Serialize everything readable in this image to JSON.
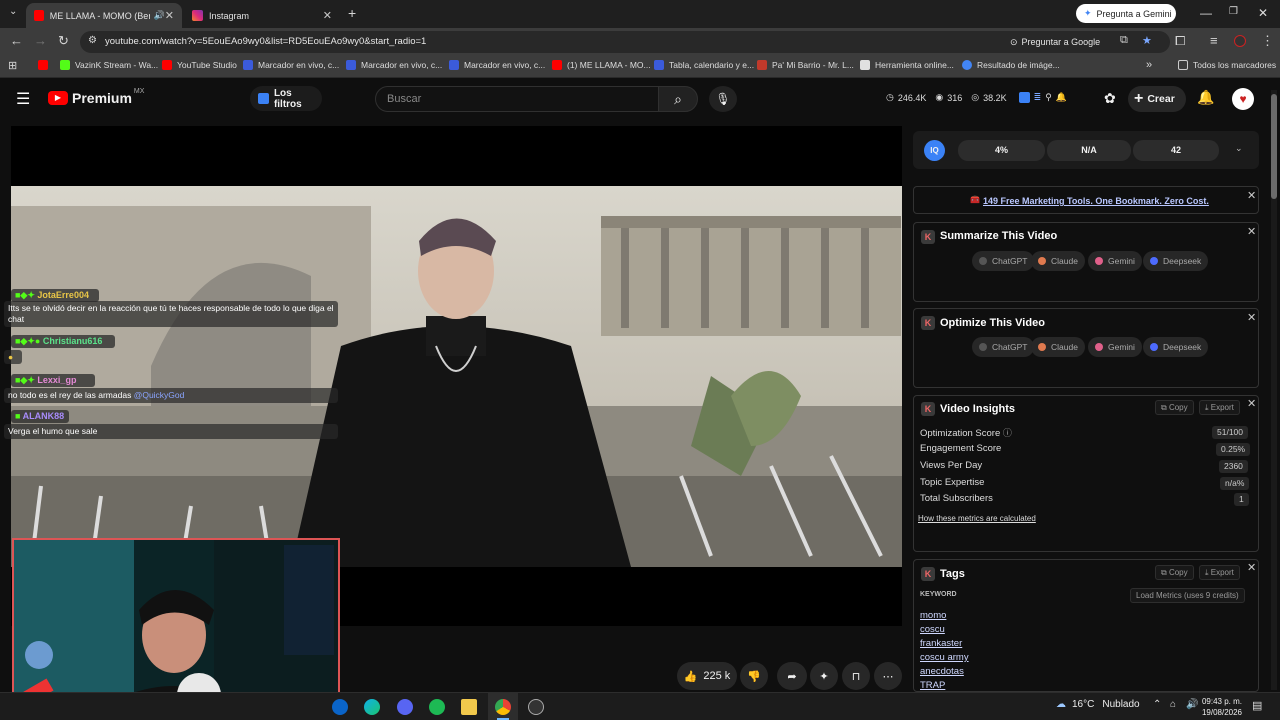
{
  "browser": {
    "tabs": [
      {
        "title": "ME LLAMA - MOMO (Beret)",
        "active": true
      },
      {
        "title": "Instagram",
        "active": false
      }
    ],
    "gemini_button": "Pregunta a Gemini",
    "url": "youtube.com/watch?v=5EouEAo9wy0&list=RD5EouEAo9wy0&start_radio=1",
    "ask_google": "Preguntar a Google",
    "bookmarks": [
      {
        "label": "",
        "color": "#ff0000"
      },
      {
        "label": "VazinK Stream - Wa...",
        "color": "#53fc18"
      },
      {
        "label": "YouTube Studio",
        "color": "#ff0000"
      },
      {
        "label": "Marcador en vivo, c...",
        "color": "#3b5bdb"
      },
      {
        "label": "Marcador en vivo, c...",
        "color": "#3b5bdb"
      },
      {
        "label": "Marcador en vivo, c...",
        "color": "#3b5bdb"
      },
      {
        "label": "(1) ME LLAMA - MO...",
        "color": "#ff0000"
      },
      {
        "label": "Tabla, calendario y e...",
        "color": "#3b5bdb"
      },
      {
        "label": "Pa' Mi Barrio - Mr. L...",
        "color": "#c0392b"
      },
      {
        "label": "Herramienta online...",
        "color": "#e0e0e0"
      },
      {
        "label": "Resultado de imáge...",
        "color": "#4285f4"
      }
    ],
    "all_bookmarks": "Todos los marcadores"
  },
  "youtube": {
    "logo": "Premium",
    "region": "MX",
    "filters": "Los filtros",
    "search_placeholder": "Buscar",
    "stats": {
      "views": "246.4K",
      "likes": "316",
      "watching": "38.2K"
    },
    "create": "Crear"
  },
  "chat": [
    {
      "user": "JotaErre004",
      "color": "#e8c547",
      "message": "Itts se te olvidó decir en la reacción que tú te haces responsable de todo lo que diga el chat"
    },
    {
      "user": "Christianu616",
      "color": "#5be38a",
      "message": ""
    },
    {
      "user": "Lexxi_gp",
      "color": "#e58ad6",
      "message": "no todo es el rey de las armadas",
      "mention": "@QuickyGod"
    },
    {
      "user": "ALANK88",
      "color": "#a78bfa",
      "message": "Verga el humo que sale"
    }
  ],
  "video_actions": {
    "likes": "225 k"
  },
  "panel": {
    "iq": {
      "score1": "4%",
      "score2": "N/A",
      "score3": "42"
    },
    "promo": "149 Free Marketing Tools. One Bookmark. Zero Cost.",
    "summarize": {
      "title": "Summarize This Video",
      "buttons": [
        "ChatGPT",
        "Claude",
        "Gemini",
        "Deepseek"
      ]
    },
    "optimize": {
      "title": "Optimize This Video",
      "buttons": [
        "ChatGPT",
        "Claude",
        "Gemini",
        "Deepseek"
      ]
    },
    "insights": {
      "title": "Video Insights",
      "copy": "Copy",
      "export": "Export",
      "metrics": [
        {
          "label": "Optimization Score",
          "value": "51/100"
        },
        {
          "label": "Engagement Score",
          "value": "0.25%"
        },
        {
          "label": "Views Per Day",
          "value": "2360"
        },
        {
          "label": "Topic Expertise",
          "value": "n/a%"
        },
        {
          "label": "Total Subscribers",
          "value": "1"
        }
      ],
      "link": "How these metrics are calculated"
    },
    "tags": {
      "title": "Tags",
      "copy": "Copy",
      "export": "Export",
      "column": "KEYWORD",
      "load": "Load Metrics (uses 9 credits)",
      "items": [
        "momo",
        "coscu",
        "frankaster",
        "coscu army",
        "anecdotas",
        "TRAP"
      ]
    }
  },
  "taskbar": {
    "weather": "16°C",
    "weather_text": "Nublado",
    "time": "09:43 p. m.",
    "date": "19/08/2026"
  }
}
